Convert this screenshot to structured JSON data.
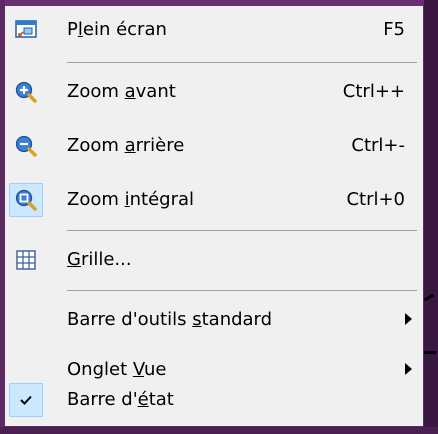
{
  "menu": {
    "items": [
      {
        "icon": "fullscreen-icon",
        "pre": "P",
        "mn": "l",
        "post": "ein écran",
        "shortcut": "F5"
      },
      {
        "icon": "zoom-in-icon",
        "pre": "Zoom ",
        "mn": "a",
        "post": "vant",
        "shortcut": "Ctrl++"
      },
      {
        "icon": "zoom-out-icon",
        "pre": "Zoom ",
        "mn": "a",
        "post": "rrière",
        "shortcut": "Ctrl+-"
      },
      {
        "icon": "zoom-fit-icon",
        "pre": "Zoom ",
        "mn": "i",
        "post": "ntégral",
        "shortcut": "Ctrl+0",
        "highlighted": true
      },
      {
        "icon": "grid-icon",
        "pre": "",
        "mn": "G",
        "post": "rille...",
        "shortcut": ""
      },
      {
        "icon": "",
        "pre": "Barre d'outils ",
        "mn": "s",
        "post": "tandard",
        "shortcut": "",
        "submenu": true
      },
      {
        "icon": "",
        "pre": "Onglet ",
        "mn": "V",
        "post": "ue",
        "shortcut": "",
        "submenu": true
      },
      {
        "icon": "check-icon",
        "pre": "Barre d'",
        "mn": "é",
        "post": "tat",
        "shortcut": "",
        "checked": true
      }
    ]
  }
}
